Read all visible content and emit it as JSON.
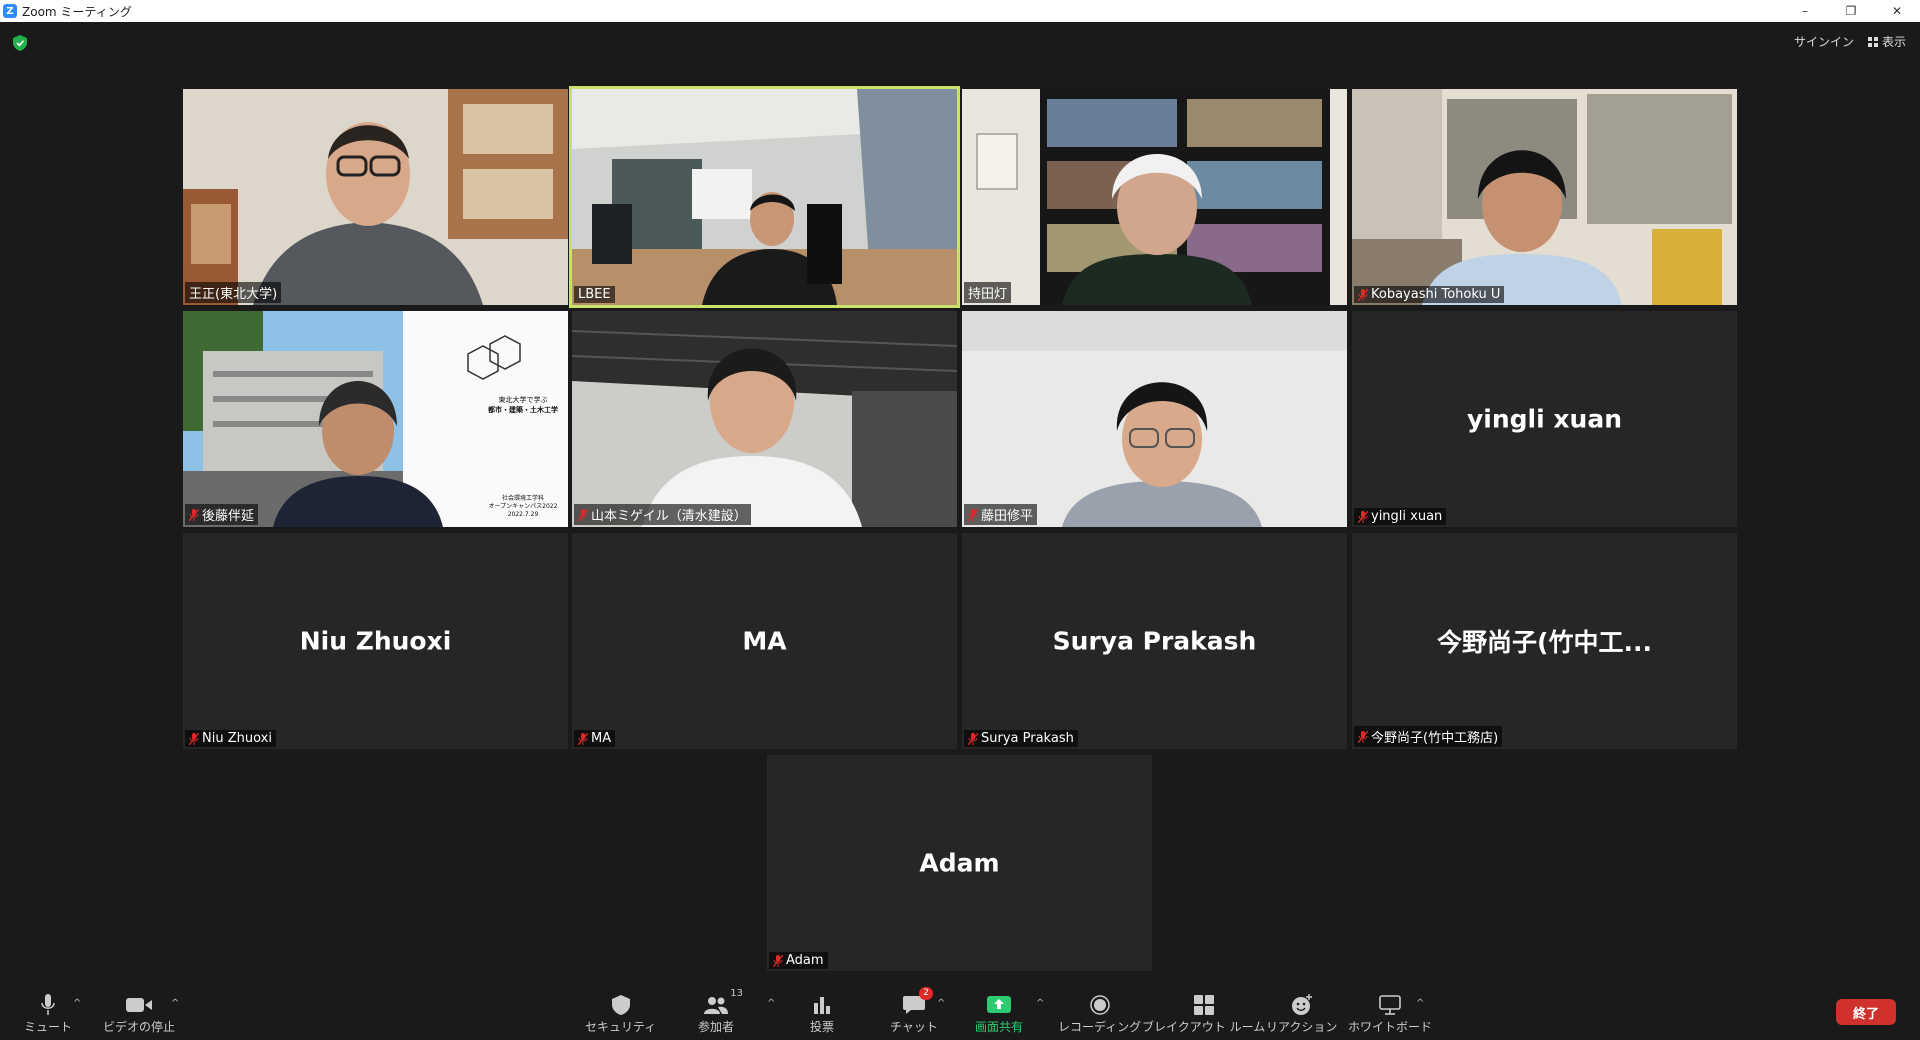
{
  "window": {
    "title": "Zoom ミーティング",
    "minimize": "–",
    "restore": "❐",
    "close": "✕"
  },
  "topbar": {
    "signin": "サインイン",
    "view": "表示"
  },
  "participants": [
    {
      "display_name": "",
      "label": "王正(東北大学)",
      "video": true,
      "muted": false,
      "active": false
    },
    {
      "display_name": "",
      "label": "LBEE",
      "video": true,
      "muted": false,
      "active": true
    },
    {
      "display_name": "",
      "label": "持田灯",
      "video": true,
      "muted": false,
      "active": false
    },
    {
      "display_name": "",
      "label": "Kobayashi Tohoku U",
      "video": true,
      "muted": true,
      "active": false
    },
    {
      "display_name": "",
      "label": "後藤伴延",
      "video": true,
      "muted": true,
      "active": false
    },
    {
      "display_name": "",
      "label": "山本ミゲイル（清水建設）",
      "video": true,
      "muted": true,
      "active": false
    },
    {
      "display_name": "",
      "label": "藤田修平",
      "video": true,
      "muted": true,
      "active": false
    },
    {
      "display_name": "yingli xuan",
      "label": "yingli xuan",
      "video": false,
      "muted": true,
      "active": false
    },
    {
      "display_name": "Niu Zhuoxi",
      "label": "Niu Zhuoxi",
      "video": false,
      "muted": true,
      "active": false
    },
    {
      "display_name": "MA",
      "label": "MA",
      "video": false,
      "muted": true,
      "active": false
    },
    {
      "display_name": "Surya Prakash",
      "label": "Surya Prakash",
      "video": false,
      "muted": true,
      "active": false
    },
    {
      "display_name": "今野尚子(竹中工...",
      "label": "今野尚子(竹中工務店)",
      "video": false,
      "muted": true,
      "active": false
    },
    {
      "display_name": "Adam",
      "label": "Adam",
      "video": false,
      "muted": true,
      "active": false
    }
  ],
  "slide_text": {
    "line1": "東北大学で学ぶ",
    "line2": "都市・建築・土木工学",
    "line3": "社会環境工学科",
    "line4": "オープンキャンパス2022",
    "line5": "2022.7.29"
  },
  "toolbar": {
    "mute": "ミュート",
    "video": "ビデオの停止",
    "security": "セキュリティ",
    "participants": "参加者",
    "participants_count": "13",
    "polls": "投票",
    "chat": "チャット",
    "chat_badge": "2",
    "share": "画面共有",
    "record": "レコーディング",
    "breakout": "ブレイクアウト ルーム",
    "reactions": "リアクション",
    "whiteboard": "ホワイトボード",
    "end": "終了"
  },
  "colors": {
    "active_border": "#c9e26a",
    "share_green": "#2ecc71",
    "end_red": "#d0312d",
    "mute_red": "#e02828"
  }
}
